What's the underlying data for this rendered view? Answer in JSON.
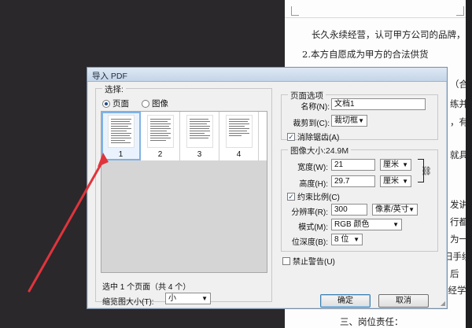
{
  "document": {
    "lines": [
      "长久永续经营，认可甲方公司的品牌，",
      "2.本方自愿成为甲方的合法供货",
      "（合",
      "练并",
      "，有",
      "就具",
      "发讲",
      "行都",
      "为一",
      "旧手续",
      "后",
      "业经学历",
      "三、岗位责任："
    ]
  },
  "dialog": {
    "title": "导入 PDF",
    "select": {
      "legend": "选择:",
      "radio_page": "页面",
      "radio_image": "图像",
      "thumbnails": [
        {
          "num": "1",
          "selected": true
        },
        {
          "num": "2",
          "selected": false
        },
        {
          "num": "3",
          "selected": false
        },
        {
          "num": "4",
          "selected": false
        }
      ],
      "status": "选中 1 个页面（共 4 个）",
      "thumb_size_label": "缩览图大小(T):",
      "thumb_size_value": "小"
    },
    "page_options": {
      "legend": "页面选项",
      "name_label": "名称(N):",
      "name_value": "文档1",
      "crop_label": "裁剪到(C):",
      "crop_value": "裁切框",
      "antialias_label": "消除锯齿(A)",
      "antialias_checked": true
    },
    "image_size": {
      "legend": "图像大小:24.9M",
      "width_label": "宽度(W):",
      "width_value": "21",
      "width_unit": "厘米",
      "height_label": "高度(H):",
      "height_value": "29.7",
      "height_unit": "厘米",
      "constrain_label": "约束比例(C)",
      "constrain_checked": true,
      "resolution_label": "分辨率(R):",
      "resolution_value": "300",
      "resolution_unit": "像素/英寸",
      "mode_label": "模式(M):",
      "mode_value": "RGB 颜色",
      "depth_label": "位深度(B):",
      "depth_value": "8 位"
    },
    "suppress_label": "禁止警告(U)",
    "suppress_checked": false,
    "ok_label": "确定",
    "cancel_label": "取消"
  },
  "colors": {
    "annotation_arrow": "#e0343c",
    "selection": "#7fb2e5"
  }
}
